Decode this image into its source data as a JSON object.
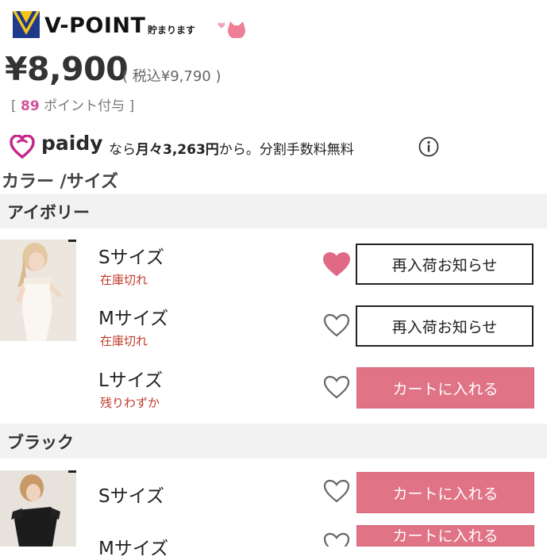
{
  "vpoint": {
    "brand": "V-POINT",
    "subtitle": "貯まります"
  },
  "price": {
    "main": "¥8,900",
    "tax_included": "( 税込¥9,790 )",
    "points_prefix": "[",
    "points_value": "89",
    "points_suffix": "ポイント付与 ]"
  },
  "paidy": {
    "brand": "paidy",
    "text_pre": "なら",
    "text_bold": "月々3,263円",
    "text_post": "から。分割手数料無料"
  },
  "section_title": "カラー /サイズ",
  "colors": [
    {
      "name": "アイボリー",
      "sizes": [
        {
          "size": "Sサイズ",
          "stock": "在庫切れ",
          "favorited": true,
          "action": "再入荷お知らせ"
        },
        {
          "size": "Mサイズ",
          "stock": "在庫切れ",
          "favorited": false,
          "action": "再入荷お知らせ"
        },
        {
          "size": "Lサイズ",
          "stock": "残りわずか",
          "favorited": false,
          "action": "カートに入れる"
        }
      ]
    },
    {
      "name": "ブラック",
      "sizes": [
        {
          "size": "Sサイズ",
          "stock": "",
          "favorited": false,
          "action": "カートに入れる"
        },
        {
          "size": "Mサイズ",
          "stock": "",
          "favorited": false,
          "action": "カートに入れる"
        }
      ]
    }
  ],
  "colors_theme": {
    "accent_pink": "#e07385",
    "heart_active": "#e06a86",
    "stock_red": "#c0392b",
    "point_pink": "#d4509a"
  }
}
